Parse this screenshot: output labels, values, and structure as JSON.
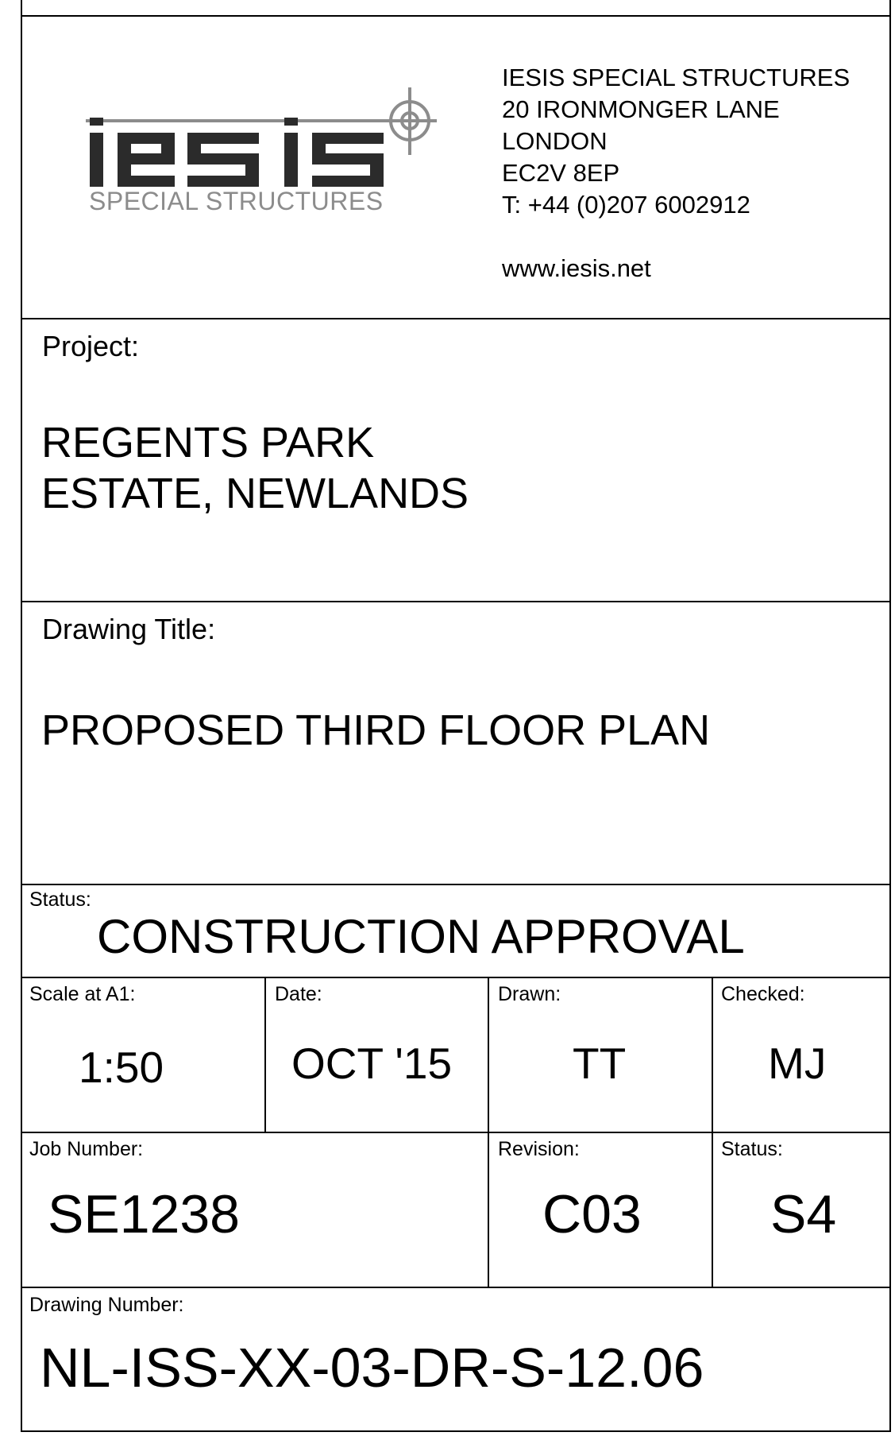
{
  "company": {
    "logo_word": "iesis",
    "logo_subtitle": "SPECIAL STRUCTURES",
    "address_lines": [
      "IESIS SPECIAL STRUCTURES",
      "20 IRONMONGER LANE",
      "LONDON",
      "EC2V 8EP",
      "T: +44 (0)207 6002912"
    ],
    "website": "www.iesis.net"
  },
  "project": {
    "label": "Project:",
    "lines": [
      "REGENTS PARK",
      "ESTATE, NEWLANDS"
    ]
  },
  "drawing_title": {
    "label": "Drawing Title:",
    "value": "PROPOSED THIRD FLOOR PLAN"
  },
  "status_banner": {
    "label": "Status:",
    "value": "CONSTRUCTION APPROVAL"
  },
  "scale": {
    "label": "Scale at A1:",
    "value": "1:50"
  },
  "date": {
    "label": "Date:",
    "value": "OCT '15"
  },
  "drawn": {
    "label": "Drawn:",
    "value": "TT"
  },
  "checked": {
    "label": "Checked:",
    "value": "MJ"
  },
  "job_number": {
    "label": "Job Number:",
    "value": "SE1238"
  },
  "revision": {
    "label": "Revision:",
    "value": "C03"
  },
  "status_code": {
    "label": "Status:",
    "value": "S4"
  },
  "drawing_number": {
    "label": "Drawing Number:",
    "value": "NL-ISS-XX-03-DR-S-12.06"
  },
  "colors": {
    "logo_dark": "#2b2b2b",
    "logo_grey": "#8c8c8c"
  }
}
